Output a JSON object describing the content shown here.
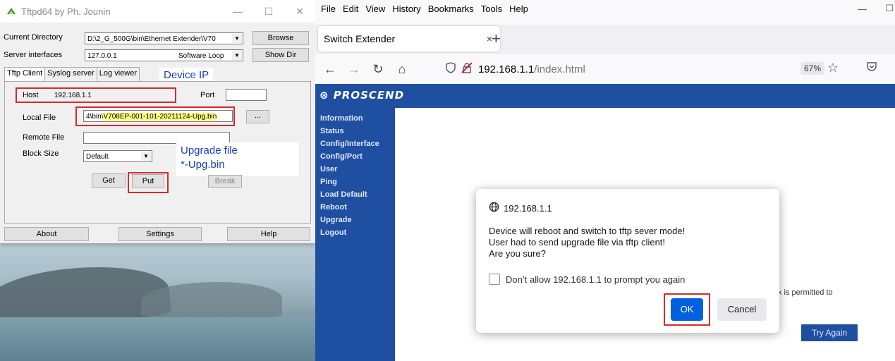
{
  "tftp": {
    "title": "Tftpd64 by Ph. Jounin",
    "controls": {
      "minimize": "—",
      "maximize": "☐",
      "close": "✕"
    },
    "current_directory_label": "Current Directory",
    "current_directory_value": "D:\\2_G_500G\\bin\\Ethernet Extender\\V70",
    "browse_label": "Browse",
    "server_interfaces_label": "Server interfaces",
    "server_interfaces_value": "127.0.0.1",
    "server_interfaces_note": "Software Loop",
    "show_dir_label": "Show Dir",
    "tabs": [
      "Tftp Client",
      "Syslog server",
      "Log viewer"
    ],
    "host_label": "Host",
    "host_value": "192.168.1.1",
    "port_label": "Port",
    "port_value": "",
    "local_file_label": "Local File",
    "local_file_prefix": "4\\bin\\",
    "local_file_value": "V708EP-001-101-20211124-Upg.bin",
    "browse_dots_label": "...",
    "remote_file_label": "Remote File",
    "remote_file_value": "",
    "block_size_label": "Block Size",
    "block_size_value": "Default",
    "get_label": "Get",
    "put_label": "Put",
    "break_label": "Break",
    "about_label": "About",
    "settings_label": "Settings",
    "help_label": "Help",
    "note_device_ip": "Device IP",
    "note_upgrade_line1": "Upgrade file",
    "note_upgrade_line2": "*-Upg.bin",
    "highlight_color": "#d12c2c",
    "note_color": "#1a3fb8"
  },
  "browser": {
    "menu": [
      "File",
      "Edit",
      "View",
      "History",
      "Bookmarks",
      "Tools",
      "Help"
    ],
    "window_min": "—",
    "tab_title": "Switch Extender",
    "tab_close": "×",
    "new_tab": "+",
    "url_host": "192.168.1.1",
    "url_path": "/index.html",
    "zoom": "67%",
    "site": {
      "logo": "PROSCEND",
      "nav": [
        "Information",
        "Status",
        "Config/Interface",
        "Config/Port",
        "User",
        "Ping",
        "Load Default",
        "Reboot",
        "Upgrade",
        "Logout"
      ],
      "bg_text_right": "x is permitted to",
      "try_again": "Try Again",
      "brand_color": "#1f4fa0"
    },
    "dialog": {
      "origin": "192.168.1.1",
      "message_lines": [
        "Device will reboot and switch to tftp sever mode!",
        "User had to send upgrade file via tftp client!",
        "Are you sure?"
      ],
      "checkbox_label": "Don’t allow 192.168.1.1 to prompt you again",
      "ok": "OK",
      "cancel": "Cancel",
      "ok_color": "#0061e0"
    }
  }
}
